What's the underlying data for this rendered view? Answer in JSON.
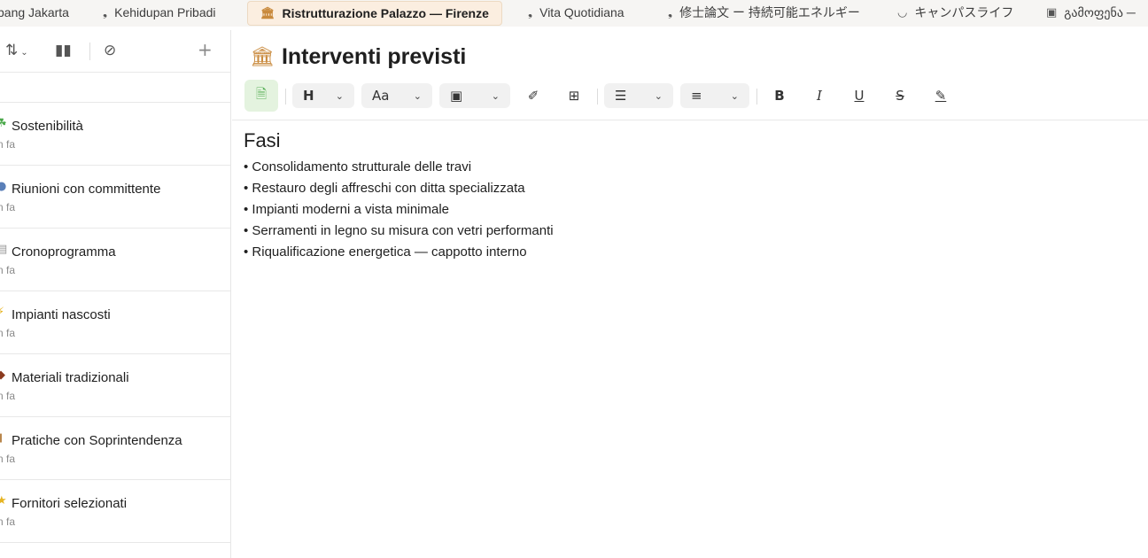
{
  "tabs": [
    {
      "label": "bang Jakarta",
      "icon": "",
      "active": false
    },
    {
      "label": "Kehidupan Pribadi",
      "icon": "leaf-icon",
      "active": false
    },
    {
      "label": "Ristrutturazione Palazzo — Firenze",
      "icon": "building-icon",
      "active": true
    },
    {
      "label": "Vita Quotidiana",
      "icon": "leaf-icon",
      "active": false
    },
    {
      "label": "修士論文 ー 持続可能エネルギー",
      "icon": "leaf-icon",
      "active": false
    },
    {
      "label": "キャンパスライフ",
      "icon": "bowl-icon",
      "active": false
    },
    {
      "label": "გამოფენა ─",
      "icon": "image-icon",
      "active": false
    }
  ],
  "sidebar": {
    "toolbar": {
      "sort_icon": "sort-icon",
      "layout_icon": "layout-icon",
      "check_icon": "check-circle-icon",
      "add_icon": "plus-icon"
    },
    "notes": [
      {
        "title": "Sostenibilità",
        "time": "n fa",
        "icon": "sprout-icon",
        "icon_color": "#4aa84a"
      },
      {
        "title": "Riunioni con committente",
        "time": "n fa",
        "icon": "people-icon",
        "icon_color": "#5a7fb8"
      },
      {
        "title": "Cronoprogramma",
        "time": "n fa",
        "icon": "calendar-icon",
        "icon_color": "#999999"
      },
      {
        "title": "Impianti nascosti",
        "time": "n fa",
        "icon": "lightning-icon",
        "icon_color": "#e6b422"
      },
      {
        "title": "Materiali tradizionali",
        "time": "n fa",
        "icon": "brick-icon",
        "icon_color": "#8b3a1e"
      },
      {
        "title": "Pratiche con Soprintendenza",
        "time": "n fa",
        "icon": "scroll-icon",
        "icon_color": "#b8864b"
      },
      {
        "title": "Fornitori selezionati",
        "time": "n fa",
        "icon": "star-icon",
        "icon_color": "#e6b422"
      }
    ]
  },
  "document": {
    "icon": "building-icon",
    "title": "Interventi previsti",
    "heading": "Fasi",
    "bullets": [
      "Consolidamento strutturale delle travi",
      "Restauro degli affreschi con ditta specializzata",
      "Impianti moderni a vista minimale",
      "Serramenti in legno su misura con vetri performanti",
      "Riqualificazione energetica — cappotto interno"
    ]
  },
  "format_toolbar": {
    "heading_label": "H",
    "text_style_label": "Aa",
    "bold_label": "B",
    "italic_label": "I",
    "underline_label": "U",
    "strike_label": "S"
  },
  "colors": {
    "accent_green": "#5cb25b",
    "active_tab_bg": "#fbeee0"
  }
}
